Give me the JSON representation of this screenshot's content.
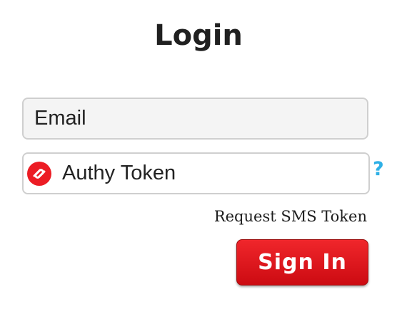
{
  "page": {
    "title": "Login"
  },
  "form": {
    "email_placeholder": "Email",
    "token_placeholder": "Authy Token",
    "help_label": "?",
    "sms_link_label": "Request SMS Token",
    "submit_label": "Sign In"
  },
  "icons": {
    "token_field_icon": "authy-logo-icon",
    "brand_color": "#ec1c24"
  },
  "colors": {
    "accent_red": "#e21a20",
    "help_blue": "#2fb0e6",
    "field_border": "#cfcfcf",
    "email_field_bg": "#f4f4f4"
  }
}
